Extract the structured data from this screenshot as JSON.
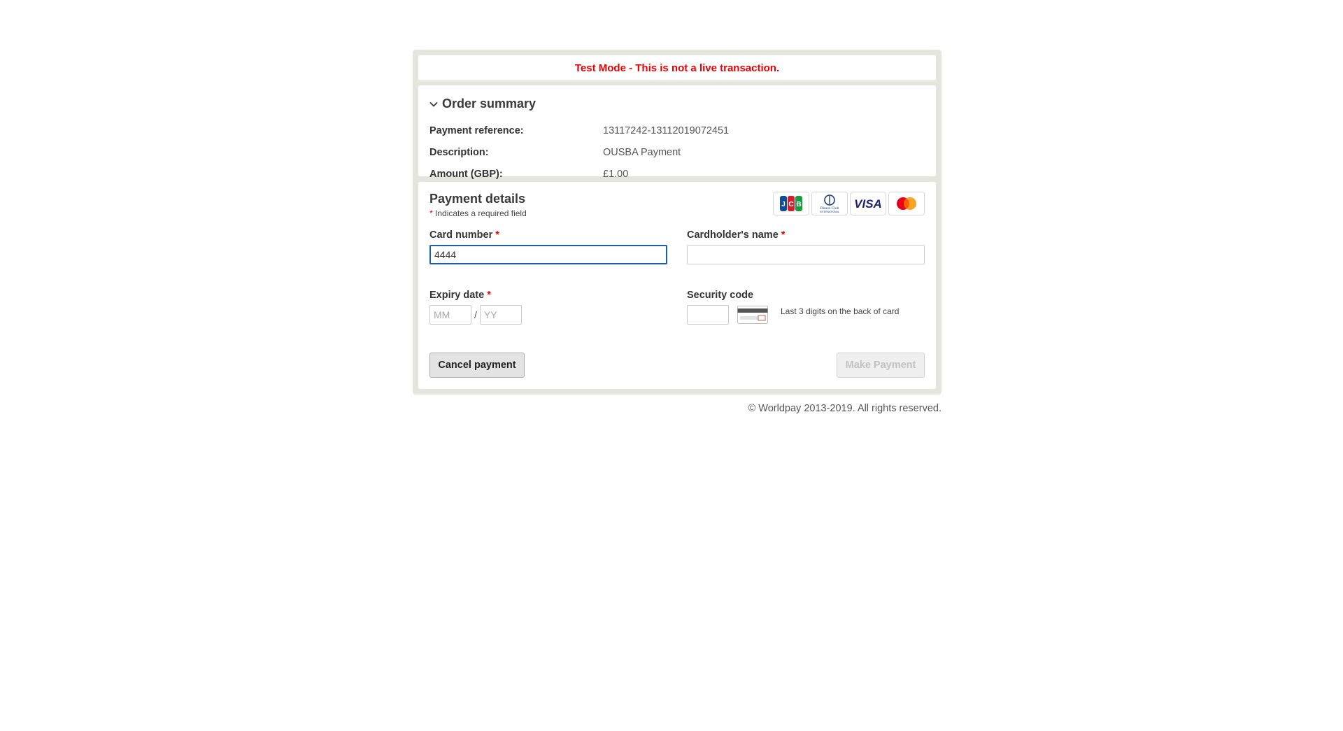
{
  "banner": {
    "text": "Test Mode - This is not a live transaction.",
    "color": "#e80000"
  },
  "order_summary": {
    "title": "Order summary",
    "toggle_icon": "chevron-down-icon",
    "rows": [
      {
        "label": "Payment reference:",
        "value": "13117242-13112019072451"
      },
      {
        "label": "Description:",
        "value": "OUSBA Payment"
      },
      {
        "label": "Amount (GBP):",
        "value": "£1.00"
      }
    ]
  },
  "payment": {
    "title": "Payment details",
    "required_star": "*",
    "required_note": "Indicates a required field",
    "card_logos": {
      "jcb": "JCB",
      "diners_line1": "Diners Club",
      "diners_line2": "INTERNATIONAL",
      "visa": "VISA"
    },
    "card_number": {
      "label": "Card number",
      "value": "4444"
    },
    "cardholder": {
      "label": "Cardholder's name",
      "value": ""
    },
    "expiry": {
      "label": "Expiry date",
      "month_placeholder": "MM",
      "separator": "/",
      "year_placeholder": "YY"
    },
    "security": {
      "label": "Security code",
      "hint": "Last 3 digits on the back of card",
      "icon": "card-back-cvv-icon"
    },
    "cancel_label": "Cancel payment",
    "submit_label": "Make Payment"
  },
  "footer": {
    "text": "© Worldpay 2013-2019. All rights reserved."
  },
  "colors": {
    "frame": "#e5e5e0",
    "focus_border": "#1f5fa8",
    "required": "#e80000"
  }
}
